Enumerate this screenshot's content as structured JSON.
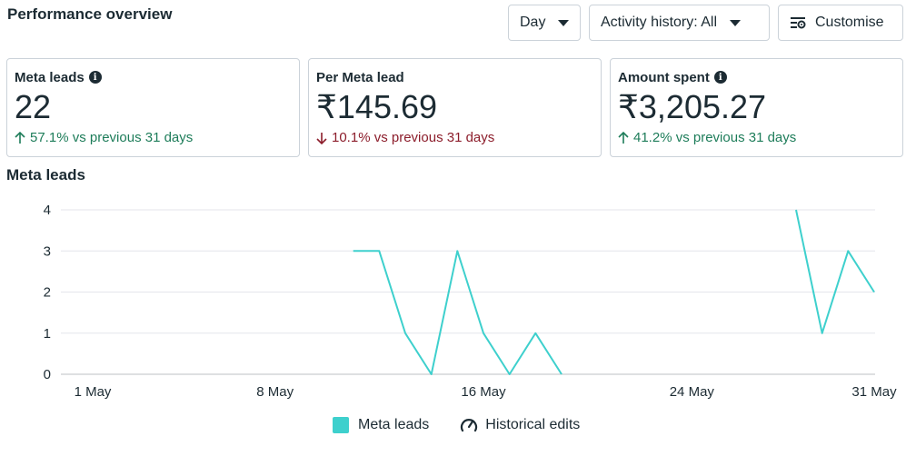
{
  "header": {
    "title": "Performance overview",
    "day_label": "Day",
    "activity_label": "Activity history: All",
    "customise_label": "Customise"
  },
  "cards": [
    {
      "title": "Meta leads",
      "has_info": true,
      "value": "22",
      "direction": "up",
      "change": "57.1% vs previous 31 days"
    },
    {
      "title": "Per Meta lead",
      "has_info": false,
      "value": "₹145.69",
      "direction": "down",
      "change": "10.1% vs previous 31 days"
    },
    {
      "title": "Amount spent",
      "has_info": true,
      "value": "₹3,205.27",
      "direction": "up",
      "change": "41.2% vs previous 31 days"
    }
  ],
  "section": {
    "title": "Meta leads"
  },
  "legend": {
    "series_label": "Meta leads",
    "edits_label": "Historical edits"
  },
  "icons": {
    "info": "info-icon",
    "settings": "settings-sliders-icon",
    "caret": "caret-down-icon",
    "gauge": "gauge-icon"
  },
  "colors": {
    "line": "#3ed0cd",
    "up": "#1e7d5a",
    "down": "#8c1d2b",
    "grid": "#e4e6eb"
  },
  "chart_data": {
    "type": "line",
    "xlabel": "",
    "ylabel": "",
    "ylim": [
      0,
      4
    ],
    "yticks": [
      0,
      1,
      2,
      3,
      4
    ],
    "xticks": [
      "1 May",
      "8 May",
      "16 May",
      "24 May",
      "31 May"
    ],
    "xtick_days": [
      1,
      8,
      16,
      24,
      31
    ],
    "grid": true,
    "series": [
      {
        "name": "Meta leads",
        "x": [
          11,
          12,
          13,
          14,
          15,
          16,
          17,
          18,
          19,
          28,
          29,
          30,
          31
        ],
        "y": [
          3,
          3,
          1,
          0,
          3,
          1,
          0,
          1,
          0,
          4,
          1,
          3,
          2
        ],
        "segments": [
          [
            11,
            19
          ],
          [
            28,
            31
          ]
        ]
      }
    ]
  }
}
